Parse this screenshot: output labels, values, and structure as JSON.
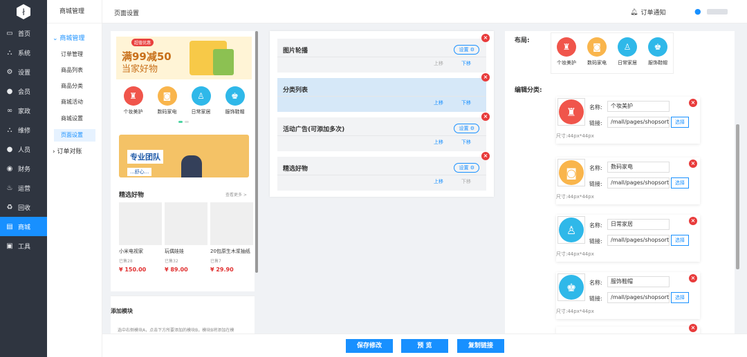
{
  "sidebar": {
    "items": [
      {
        "label": "首页",
        "icon": "monitor-icon",
        "glyph": "▭"
      },
      {
        "label": "系统",
        "icon": "sitemap-icon",
        "glyph": "⛬"
      },
      {
        "label": "设置",
        "icon": "gear-icon",
        "glyph": "⚙"
      },
      {
        "label": "会员",
        "icon": "user-icon",
        "glyph": "●"
      },
      {
        "label": "家政",
        "icon": "link-icon",
        "glyph": "∞"
      },
      {
        "label": "维修",
        "icon": "sitemap-icon",
        "glyph": "⛬"
      },
      {
        "label": "人员",
        "icon": "user-icon",
        "glyph": "●"
      },
      {
        "label": "财务",
        "icon": "coin-icon",
        "glyph": "◉"
      },
      {
        "label": "运营",
        "icon": "fire-icon",
        "glyph": "♨"
      },
      {
        "label": "回收",
        "icon": "recycle-icon",
        "glyph": "♻"
      },
      {
        "label": "商城",
        "icon": "shop-icon",
        "glyph": "▤"
      },
      {
        "label": "工具",
        "icon": "toolbox-icon",
        "glyph": "▣"
      }
    ]
  },
  "subnav": {
    "header": "商城管理",
    "group": "商城管理",
    "items": [
      "订单管理",
      "商品列表",
      "商品分类",
      "商城活动",
      "商城设置",
      "页面设置"
    ],
    "group2": "订单对账"
  },
  "topbar": {
    "title": "页面设置",
    "notice": "订单通知"
  },
  "preview": {
    "banner": {
      "tag": "超值优惠",
      "line1": "满99减50",
      "line2": "当家好物"
    },
    "categories": [
      {
        "label": "个妆美护",
        "color": "#f0554b",
        "glyph": "♜"
      },
      {
        "label": "数码家电",
        "color": "#f9b54c",
        "glyph": "◙"
      },
      {
        "label": "日常家居",
        "color": "#2fb8e9",
        "glyph": "♙"
      },
      {
        "label": "服饰鞋帽",
        "color": "#2fb8e9",
        "glyph": "♚"
      }
    ],
    "ad": {
      "t1": "专业团队",
      "t2": "...舒心..."
    },
    "section_title": "精选好物",
    "more": "查看更多 >",
    "products": [
      {
        "name": "小米电视家",
        "sold": "已售28",
        "price": "¥ 150.00"
      },
      {
        "name": "玩偶娃娃",
        "sold": "已售32",
        "price": "¥ 89.00"
      },
      {
        "name": "20包原生木浆抽纸",
        "sold": "已售7",
        "price": "¥ 29.90"
      }
    ]
  },
  "add_module": {
    "title": "添加模块",
    "desc": "选中右侧模块A，点击下方所要添加的模块B，模块B将添加在模"
  },
  "modules": [
    {
      "name": "图片轮播",
      "setting": "设置 ⚙",
      "up": "上移",
      "down": "下移",
      "up_enabled": false,
      "down_enabled": true,
      "selected": false
    },
    {
      "name": "分类列表",
      "setting": "",
      "up": "上移",
      "down": "下移",
      "up_enabled": true,
      "down_enabled": true,
      "selected": true
    },
    {
      "name": "活动广告(可添加多次)",
      "setting": "设置 ⚙",
      "up": "上移",
      "down": "下移",
      "up_enabled": true,
      "down_enabled": true,
      "selected": false
    },
    {
      "name": "精选好物",
      "setting": "设置 ⚙",
      "up": "上移",
      "down": "下移",
      "up_enabled": true,
      "down_enabled": false,
      "selected": false
    }
  ],
  "editor": {
    "layout_label": "布局:",
    "edit_label": "编辑分类:",
    "name_label": "名称:",
    "link_label": "链接:",
    "pick": "选择",
    "size": "尺寸:44px*44px",
    "items": [
      {
        "name": "个妆美护",
        "link": "/mall/pages/shopsort?cate"
      },
      {
        "name": "数码家电",
        "link": "/mall/pages/shopsort?cate"
      },
      {
        "name": "日常家居",
        "link": "/mall/pages/shopsort?cate"
      },
      {
        "name": "服饰鞋帽",
        "link": "/mall/pages/shopsort?cate"
      }
    ]
  },
  "actions": {
    "save": "保存修改",
    "preview": "预 览",
    "copy": "复制链接"
  }
}
